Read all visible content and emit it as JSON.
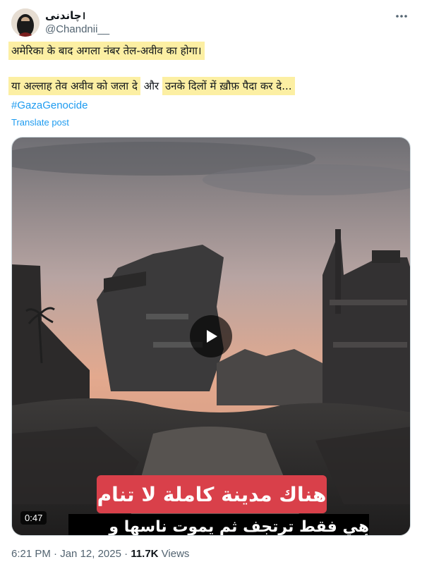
{
  "author": {
    "display_name": "چاندنی।",
    "handle": "@Chandnii__"
  },
  "post": {
    "line1": "अमेरिका के बाद अगला नंबर तेल-अवीव का होगा।",
    "line2_part1": "या अल्लाह तेव अवीव को जला दे",
    "line2_part2": " और ",
    "line2_part3": "उनके दिलों में ख़ौफ़ पैदा कर दे...",
    "hashtag": "#GazaGenocide",
    "translate_label": "Translate post"
  },
  "video": {
    "caption_top": "هناك مدينة كاملة لا تنام",
    "caption_bottom": "هي فقط ترتجف ثم يموت ناسها و أطفالها من",
    "duration": "0:47"
  },
  "footer": {
    "time": "6:21 PM",
    "separator": " · ",
    "date": "Jan 12, 2025",
    "views_count": "11.7K",
    "views_label": " Views"
  },
  "colors": {
    "link": "#1d9bf0",
    "highlight": "#fcefa3",
    "secondary_text": "#536471"
  }
}
